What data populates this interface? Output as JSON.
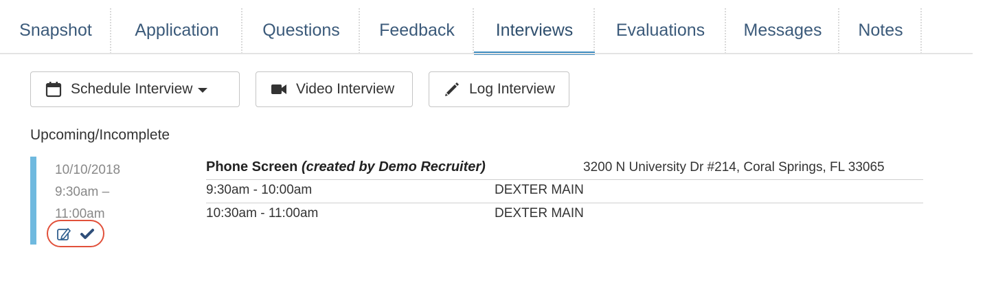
{
  "tabs": [
    {
      "label": "Snapshot",
      "active": false
    },
    {
      "label": "Application",
      "active": false
    },
    {
      "label": "Questions",
      "active": false
    },
    {
      "label": "Feedback",
      "active": false
    },
    {
      "label": "Interviews",
      "active": true
    },
    {
      "label": "Evaluations",
      "active": false
    },
    {
      "label": "Messages",
      "active": false
    },
    {
      "label": "Notes",
      "active": false
    }
  ],
  "toolbar": {
    "schedule_label": "Schedule Interview",
    "video_label": "Video Interview",
    "log_label": "Log Interview"
  },
  "section": {
    "title": "Upcoming/Incomplete"
  },
  "interview": {
    "date": "10/10/2018",
    "time_start": "9:30am –",
    "time_end": "11:00am",
    "title": "Phone Screen",
    "creator": "(created by Demo Recruiter)",
    "address": "3200 N University Dr #214, Coral Springs, FL 33065",
    "slots": [
      {
        "time": "9:30am - 10:00am",
        "person": "DEXTER MAIN"
      },
      {
        "time": "10:30am - 11:00am",
        "person": "DEXTER MAIN"
      }
    ]
  },
  "colors": {
    "tab_text": "#3b5a7a",
    "active_underline": "#3f8cc0",
    "accent_bar": "#6fb9df",
    "highlight_circle": "#e1503a",
    "icon": "#2f5e8e"
  },
  "icons": [
    "calendar-icon",
    "caret-down-icon",
    "video-camera-icon",
    "pencil-icon",
    "edit-icon",
    "check-icon"
  ]
}
